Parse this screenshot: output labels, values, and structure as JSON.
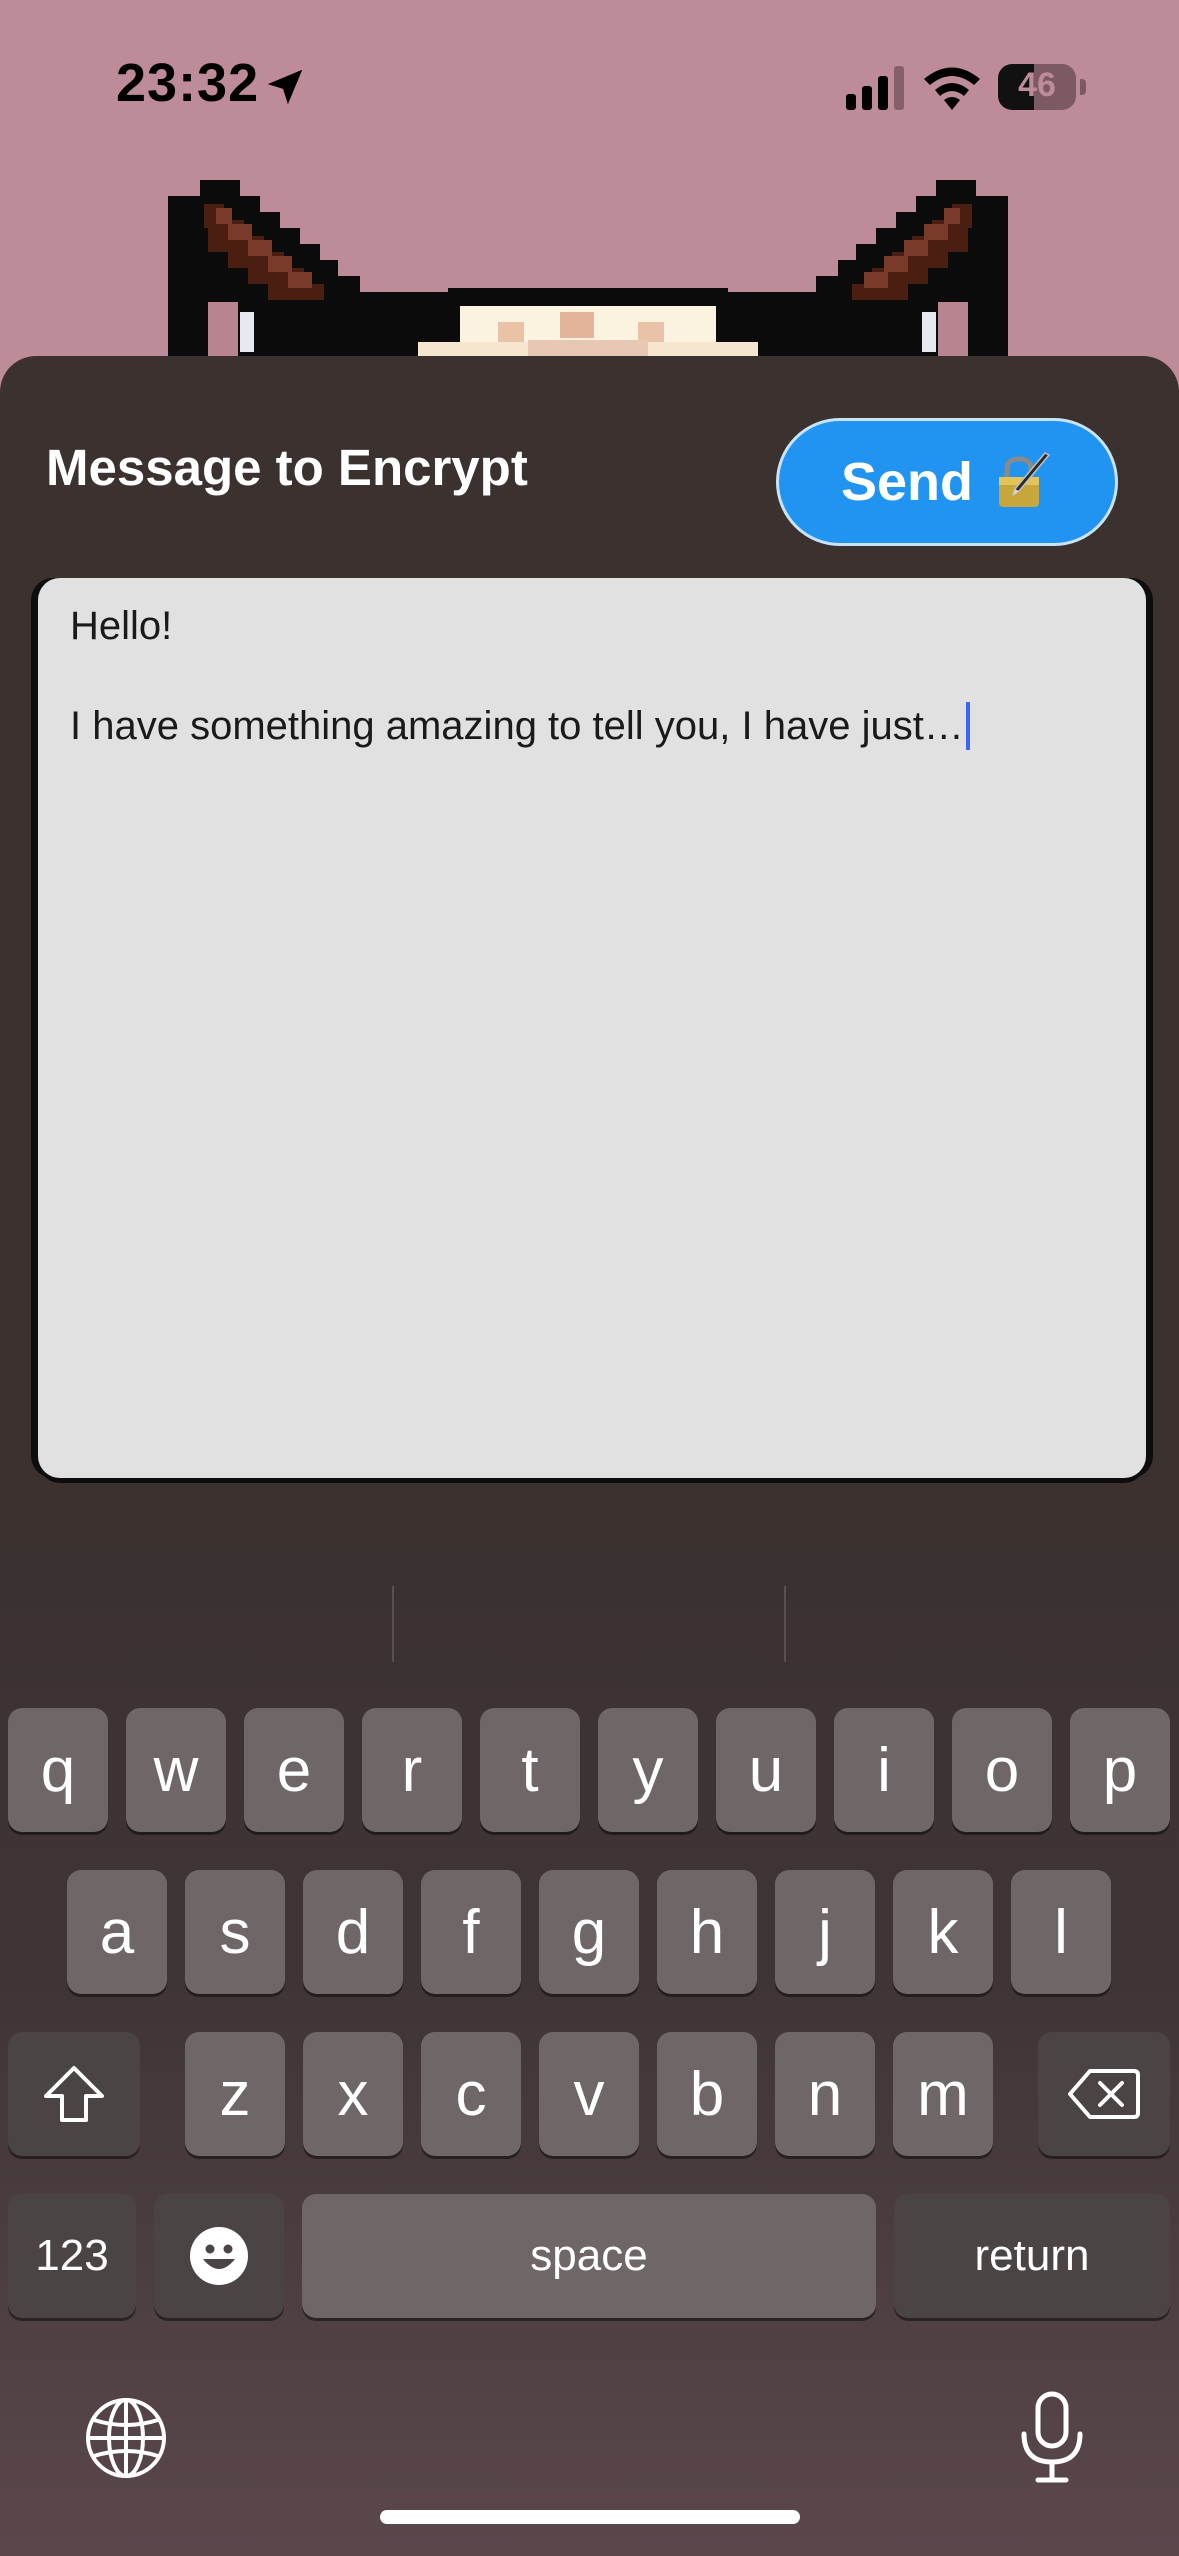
{
  "status_bar": {
    "time": "23:32",
    "battery_level": "46",
    "battery_fraction": 0.46,
    "icons": [
      "location-arrow-icon",
      "cellular-signal-icon",
      "wifi-icon",
      "battery-icon"
    ]
  },
  "sheet": {
    "title": "Message to Encrypt",
    "send_label": "Send",
    "send_icon": "fountain-pen-lock-icon",
    "accent_color": "#2194f2"
  },
  "message": {
    "line1": "Hello!",
    "line2": "I have something amazing to tell you, I have just…"
  },
  "keyboard": {
    "row1": [
      "q",
      "w",
      "e",
      "r",
      "t",
      "y",
      "u",
      "i",
      "o",
      "p"
    ],
    "row2": [
      "a",
      "s",
      "d",
      "f",
      "g",
      "h",
      "j",
      "k",
      "l"
    ],
    "row3": [
      "z",
      "x",
      "c",
      "v",
      "b",
      "n",
      "m"
    ],
    "numbers_label": "123",
    "space_label": "space",
    "return_label": "return",
    "icons": [
      "shift-icon",
      "backspace-icon",
      "emoji-icon",
      "globe-icon",
      "microphone-icon"
    ]
  },
  "colors": {
    "background": "#be8b99",
    "sheet": "#3b3230",
    "text_area": "#e1e1e1",
    "caret": "#3b63f5"
  }
}
